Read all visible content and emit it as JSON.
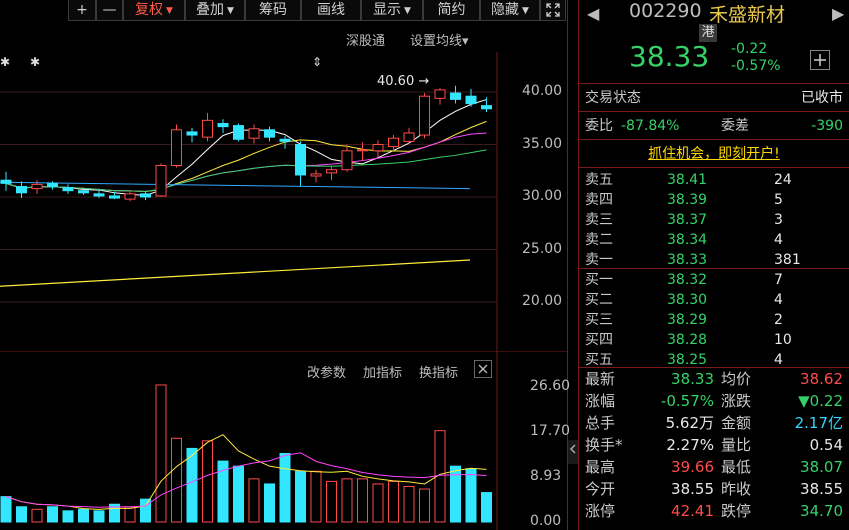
{
  "toolbar": {
    "plus": "+",
    "minus": "—",
    "items": [
      {
        "label": "复权",
        "caret": "▼",
        "active": true
      },
      {
        "label": "叠加",
        "caret": "▼",
        "active": false
      },
      {
        "label": "筹码",
        "caret": "",
        "active": false
      },
      {
        "label": "画线",
        "caret": "",
        "active": false
      },
      {
        "label": "显示",
        "caret": "▼",
        "active": false
      },
      {
        "label": "简约",
        "caret": "",
        "active": false
      },
      {
        "label": "隐藏",
        "caret": "▼",
        "active": false
      }
    ],
    "expand_icon": "expand-icon"
  },
  "chart": {
    "link_shengutong": "深股通",
    "link_setma": "设置均线",
    "setma_caret": "▾",
    "high_annot": "40.60",
    "price_ticks": [
      "40.00",
      "35.00",
      "30.00",
      "25.00",
      "20.00"
    ],
    "indicator_links": {
      "params": "改参数",
      "add": "加指标",
      "switch": "换指标"
    },
    "volume_ticks": [
      "26.60",
      "17.70",
      "8.93",
      "0.00"
    ],
    "colors": {
      "up": "#ff4a4a",
      "down": "#33e6ff",
      "ma5": "#ffffff",
      "ma10": "#ffeb3b",
      "ma20": "#ff44ff",
      "ma30": "#35d26a",
      "ma60": "#33aaff",
      "ma250": "#ffeb3b"
    }
  },
  "chart_data": {
    "type": "candlestick",
    "y_range": [
      20.0,
      40.0
    ],
    "candles": [
      {
        "o": 31.6,
        "c": 31.3,
        "h": 32.4,
        "l": 30.6
      },
      {
        "o": 31.0,
        "c": 30.4,
        "h": 31.5,
        "l": 29.9
      },
      {
        "o": 30.8,
        "c": 31.2,
        "h": 31.6,
        "l": 30.3
      },
      {
        "o": 31.3,
        "c": 31.0,
        "h": 31.5,
        "l": 30.7
      },
      {
        "o": 30.9,
        "c": 30.6,
        "h": 31.2,
        "l": 30.3
      },
      {
        "o": 30.6,
        "c": 30.4,
        "h": 30.9,
        "l": 30.2
      },
      {
        "o": 30.3,
        "c": 30.1,
        "h": 30.8,
        "l": 29.9
      },
      {
        "o": 30.1,
        "c": 29.9,
        "h": 30.5,
        "l": 29.8
      },
      {
        "o": 29.8,
        "c": 30.3,
        "h": 30.6,
        "l": 29.6
      },
      {
        "o": 30.3,
        "c": 30.0,
        "h": 30.6,
        "l": 29.7
      },
      {
        "o": 30.1,
        "c": 33.0,
        "h": 33.2,
        "l": 30.0
      },
      {
        "o": 33.0,
        "c": 36.4,
        "h": 36.9,
        "l": 32.8
      },
      {
        "o": 36.2,
        "c": 35.9,
        "h": 36.6,
        "l": 35.2
      },
      {
        "o": 35.7,
        "c": 37.3,
        "h": 38.0,
        "l": 35.3
      },
      {
        "o": 37.0,
        "c": 36.7,
        "h": 37.4,
        "l": 36.1
      },
      {
        "o": 36.8,
        "c": 35.5,
        "h": 37.0,
        "l": 35.3
      },
      {
        "o": 35.6,
        "c": 36.5,
        "h": 36.9,
        "l": 35.1
      },
      {
        "o": 36.4,
        "c": 35.7,
        "h": 36.7,
        "l": 35.3
      },
      {
        "o": 35.5,
        "c": 35.3,
        "h": 35.8,
        "l": 34.6
      },
      {
        "o": 35.0,
        "c": 32.1,
        "h": 35.3,
        "l": 31.0
      },
      {
        "o": 32.0,
        "c": 32.2,
        "h": 32.6,
        "l": 31.4
      },
      {
        "o": 32.3,
        "c": 32.6,
        "h": 33.0,
        "l": 31.6
      },
      {
        "o": 32.6,
        "c": 34.4,
        "h": 35.0,
        "l": 32.4
      },
      {
        "o": 34.4,
        "c": 34.5,
        "h": 35.2,
        "l": 33.5
      },
      {
        "o": 34.4,
        "c": 35.0,
        "h": 35.4,
        "l": 33.8
      },
      {
        "o": 34.8,
        "c": 35.6,
        "h": 35.9,
        "l": 34.3
      },
      {
        "o": 35.3,
        "c": 36.1,
        "h": 36.6,
        "l": 35.1
      },
      {
        "o": 35.9,
        "c": 39.6,
        "h": 39.9,
        "l": 35.6
      },
      {
        "o": 39.4,
        "c": 40.2,
        "h": 40.4,
        "l": 38.8
      },
      {
        "o": 39.9,
        "c": 39.3,
        "h": 40.6,
        "l": 38.9
      },
      {
        "o": 39.6,
        "c": 38.9,
        "h": 40.3,
        "l": 38.6
      },
      {
        "o": 38.7,
        "c": 38.4,
        "h": 39.5,
        "l": 38.1
      }
    ],
    "volume": [
      5,
      3,
      2.5,
      3,
      2.2,
      2.5,
      2.2,
      3.5,
      3,
      4.5,
      27,
      16.5,
      14.5,
      16,
      12,
      11,
      8.5,
      7.5,
      13.5,
      10,
      10,
      8,
      8.5,
      8.5,
      7.5,
      8,
      7,
      6.5,
      18,
      11,
      10.5,
      5.8
    ],
    "volume_range": [
      0,
      26.6
    ]
  },
  "quote": {
    "code": "002290",
    "name": "禾盛新材",
    "hk_badge": "港",
    "price": "38.33",
    "change": "-0.22",
    "change_pct": "-0.57%",
    "status_label": "交易状态",
    "status_value": "已收市",
    "ratio_label": "委比",
    "ratio_value": "-87.84%",
    "diff_label": "委差",
    "diff_value": "-390",
    "promo": "抓住机会，即刻开户!",
    "asks": [
      {
        "label": "卖五",
        "price": "38.41",
        "vol": "24"
      },
      {
        "label": "卖四",
        "price": "38.39",
        "vol": "5"
      },
      {
        "label": "卖三",
        "price": "38.37",
        "vol": "3"
      },
      {
        "label": "卖二",
        "price": "38.34",
        "vol": "4"
      },
      {
        "label": "卖一",
        "price": "38.33",
        "vol": "381"
      }
    ],
    "bids": [
      {
        "label": "买一",
        "price": "38.32",
        "vol": "7"
      },
      {
        "label": "买二",
        "price": "38.30",
        "vol": "4"
      },
      {
        "label": "买三",
        "price": "38.29",
        "vol": "2"
      },
      {
        "label": "买四",
        "price": "38.28",
        "vol": "10"
      },
      {
        "label": "买五",
        "price": "38.25",
        "vol": "4"
      }
    ],
    "stats": [
      {
        "l1": "最新",
        "v1": "38.33",
        "c1": "green",
        "l2": "均价",
        "v2": "38.62",
        "c2": "red"
      },
      {
        "l1": "涨幅",
        "v1": "-0.57%",
        "c1": "green",
        "l2": "涨跌",
        "v2": "▼0.22",
        "c2": "green"
      },
      {
        "l1": "总手",
        "v1": "5.62万",
        "c1": "white",
        "l2": "金额",
        "v2": "2.17亿",
        "c2": "cyan"
      },
      {
        "l1": "换手*",
        "v1": "2.27%",
        "c1": "white",
        "l2": "量比",
        "v2": "0.54",
        "c2": "white"
      },
      {
        "l1": "最高",
        "v1": "39.66",
        "c1": "red",
        "l2": "最低",
        "v2": "38.07",
        "c2": "green"
      },
      {
        "l1": "今开",
        "v1": "38.55",
        "c1": "white",
        "l2": "昨收",
        "v2": "38.55",
        "c2": "white"
      },
      {
        "l1": "涨停",
        "v1": "42.41",
        "c1": "red",
        "l2": "跌停",
        "v2": "34.70",
        "c2": "green"
      }
    ]
  }
}
